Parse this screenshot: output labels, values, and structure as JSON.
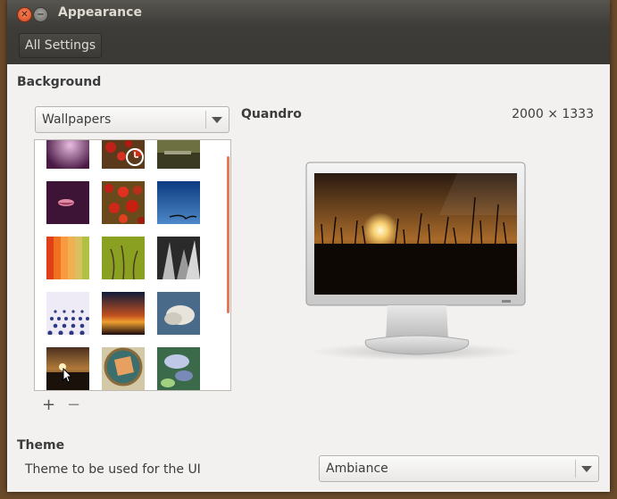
{
  "window": {
    "title": "Appearance"
  },
  "toolbar": {
    "all_settings_label": "All Settings"
  },
  "background": {
    "section_title": "Background",
    "source_select": "Wallpapers",
    "add_label": "+",
    "remove_label": "−",
    "selected_name": "Quandro",
    "selected_size": "2000 × 1333",
    "thumbnails": [
      "purple-glow",
      "berries-clock",
      "olive-landscape",
      "purple-lips",
      "red-berries",
      "blue-sky-branch",
      "orange-curtain",
      "green-stems",
      "bw-skyscrapers",
      "purple-dots",
      "dusk-clouds",
      "cloud-sky",
      "quandro-sunset",
      "tan-tile",
      "blue-flower"
    ]
  },
  "theme": {
    "section_title": "Theme",
    "label": "Theme to be used for the UI",
    "value": "Ambiance"
  },
  "colors": {
    "accent": "#e3795a",
    "titlebar": "#3d3c38",
    "window_bg": "#f2f1f0"
  }
}
